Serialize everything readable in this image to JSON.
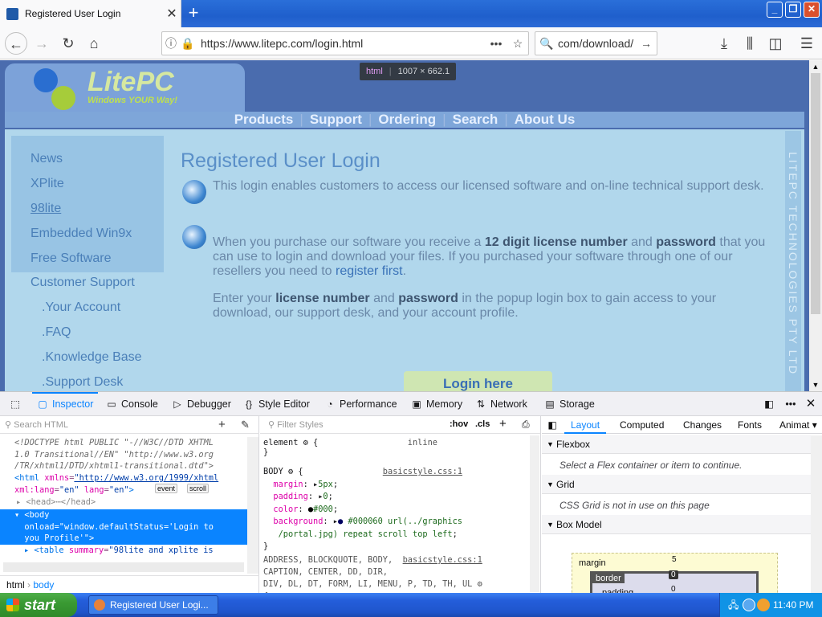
{
  "browser": {
    "tab_title": "Registered User Login",
    "url": "https://www.litepc.com/login.html",
    "search_value": "com/download/"
  },
  "page": {
    "logo_text": "LitePC",
    "logo_sub": "Windows YOUR Way!",
    "topnav": [
      "Products",
      "Support",
      "Ordering",
      "Search",
      "About Us"
    ],
    "leftnav": [
      "News",
      "XPlite",
      "98lite",
      "Embedded Win9x",
      "Free Software",
      "Customer Support"
    ],
    "subnav": [
      "Your Account",
      "FAQ",
      "Knowledge Base",
      "Support Desk"
    ],
    "heading": "Registered User Login",
    "para1": "This login enables customers to access our licensed software and on-line technical support desk.",
    "para2_a": "When you purchase our software you receive a ",
    "para2_b": "12 digit license number",
    "para2_c": " and ",
    "para2_d": "password",
    "para2_e": " that you can use to login and download your files. If you purchased your software through one of our resellers you need to ",
    "para2_link": "register first",
    "para2_f": ".",
    "para3_a": "Enter your ",
    "para3_b": "license number",
    "para3_c": " and ",
    "para3_d": "password",
    "para3_e": " in the popup login box to gain access to your download, our support desk, and your account profile.",
    "side_text": "LITEPC TECHNOLOGIES PTY LTD",
    "login_button": "Login here"
  },
  "tooltip": {
    "tag": "html",
    "size": "1007 × 662.1"
  },
  "devtools": {
    "tabs": [
      "Inspector",
      "Console",
      "Debugger",
      "Style Editor",
      "Performance",
      "Memory",
      "Network",
      "Storage"
    ],
    "search_placeholder": "Search HTML",
    "filter_placeholder": "Filter Styles",
    "hov": ":hov",
    "cls": ".cls",
    "breadcrumb": [
      "html",
      "body"
    ],
    "layout_tabs": [
      "Layout",
      "Computed",
      "Changes",
      "Fonts",
      "Animat"
    ],
    "flexbox": "Flexbox",
    "flexbox_msg": "Select a Flex container or item to continue.",
    "grid": "Grid",
    "grid_msg": "CSS Grid is not in use on this page",
    "boxmodel": "Box Model",
    "margin_label": "margin",
    "margin_val": "5",
    "border_label": "border",
    "border_val": "0",
    "padding_label": "padding",
    "padding_val": "0"
  },
  "taskbar": {
    "start": "start",
    "task": "Registered User Logi...",
    "clock": "11:40 PM"
  },
  "colors": {
    "accent": "#0a84ff",
    "page_bg": "#4a6cae",
    "content_bg": "#b1d7ec"
  }
}
